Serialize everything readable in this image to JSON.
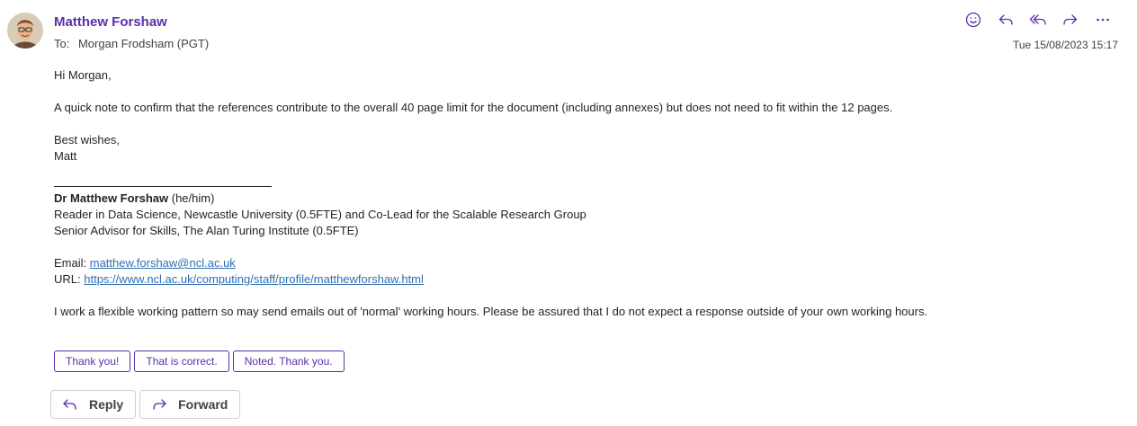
{
  "message": {
    "sender": "Matthew Forshaw",
    "to_label": "To:",
    "recipient": "Morgan Frodsham (PGT)",
    "datetime": "Tue 15/08/2023 15:17"
  },
  "toolbar_icons": [
    "smiley-icon",
    "reply-icon",
    "reply-all-icon",
    "forward-icon",
    "more-icon"
  ],
  "body": {
    "greeting": "Hi Morgan,",
    "paragraph": "A quick note to confirm that the references contribute to the overall 40 page limit for the document (including annexes) but does not need to fit within the 12 pages.",
    "closing": "Best wishes,",
    "signoff": "Matt"
  },
  "signature": {
    "name": "Dr Matthew Forshaw",
    "pronouns": "(he/him)",
    "role1": "Reader in Data Science, Newcastle University (0.5FTE) and Co-Lead for the Scalable Research Group",
    "role2": "Senior Advisor for Skills, The Alan Turing Institute (0.5FTE)",
    "email_label": "Email:",
    "email": "matthew.forshaw@ncl.ac.uk",
    "url_label": "URL:",
    "url": "https://www.ncl.ac.uk/computing/staff/profile/matthewforshaw.html",
    "note": "I work a flexible working pattern so may send emails out of 'normal' working hours.  Please be assured that I do not expect a response outside of your own working hours."
  },
  "suggested_replies": [
    "Thank you!",
    "That is correct.",
    "Noted. Thank you."
  ],
  "buttons": {
    "reply": "Reply",
    "forward": "Forward"
  },
  "colors": {
    "sender": "#5b2fa8",
    "link": "#2f6fb3",
    "icon": "#5b2fa8"
  }
}
